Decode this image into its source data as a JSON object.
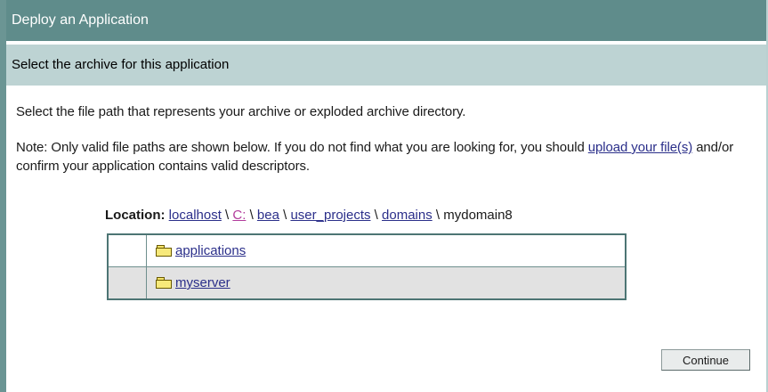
{
  "window": {
    "title": "Deploy an Application"
  },
  "section": {
    "header": "Select the archive for this application"
  },
  "intro_text": "Select the file path that represents your archive or exploded archive directory.",
  "note": {
    "prefix": "Note: Only valid file paths are shown below. If you do not find what you are looking for, you should ",
    "link": "upload your file(s)",
    "suffix": " and/or confirm your application contains valid descriptors."
  },
  "location": {
    "label": "Location:",
    "separator": "\\",
    "crumbs": [
      {
        "label": "localhost",
        "link": true
      },
      {
        "label": "C:",
        "link": true
      },
      {
        "label": "bea",
        "link": true
      },
      {
        "label": "user_projects",
        "link": true
      },
      {
        "label": "domains",
        "link": true
      },
      {
        "label": "mydomain8",
        "link": false
      }
    ]
  },
  "files": [
    {
      "name": "applications",
      "icon": "folder-icon"
    },
    {
      "name": "myserver",
      "icon": "folder-icon"
    }
  ],
  "actions": {
    "continue_label": "Continue"
  },
  "colors": {
    "title_bar": "#5f8c8b",
    "section_header": "#bdd3d3",
    "link": "#2b2f8a",
    "visited_link": "#b23c9c",
    "row_alt": "#e2e2e2"
  }
}
